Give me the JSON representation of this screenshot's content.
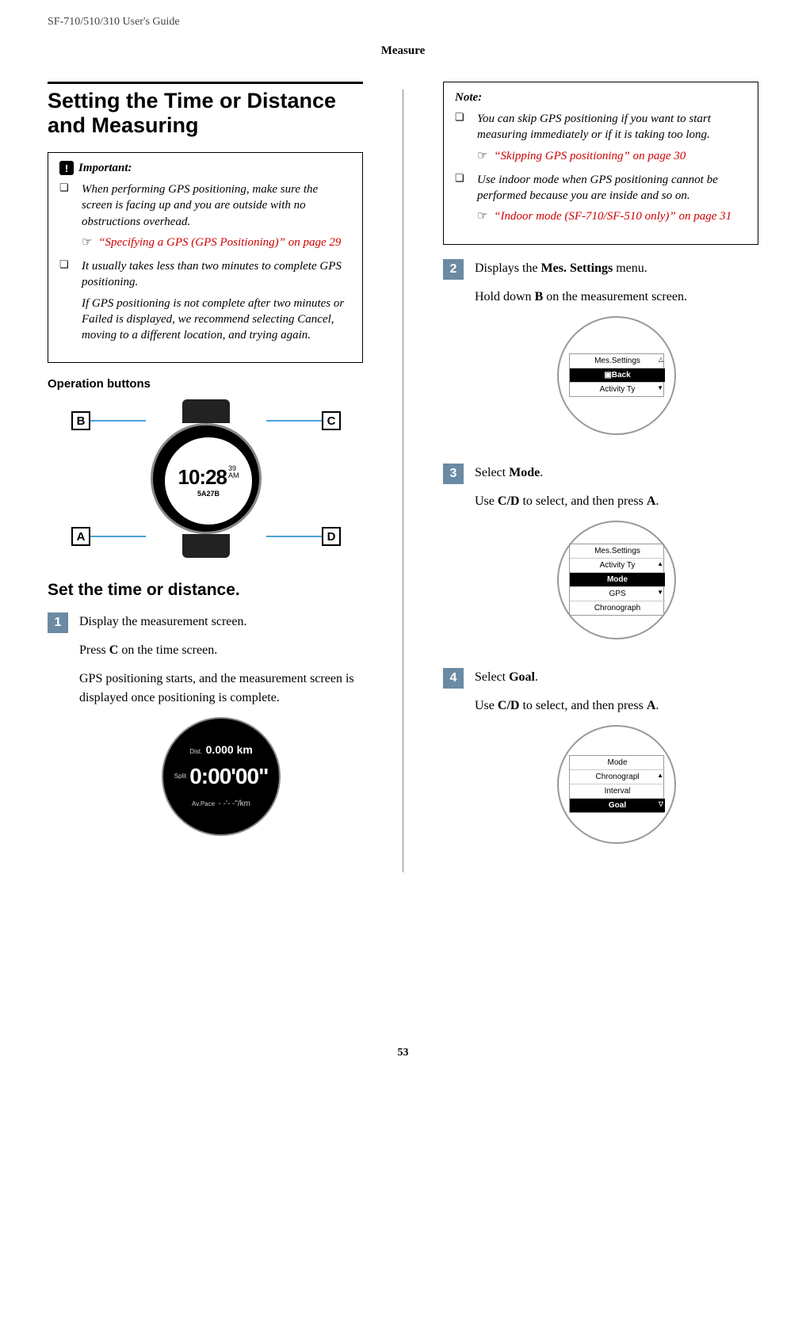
{
  "header": {
    "product": "SF-710/510/310     User's Guide",
    "section": "Measure"
  },
  "left": {
    "title": "Setting the Time or Distance and Measuring",
    "important": {
      "label": "Important:",
      "items": [
        {
          "text": "When performing GPS positioning, make sure the screen is facing up and you are outside with no obstructions overhead.",
          "link": "“Specifying a GPS (GPS Positioning)” on page 29"
        },
        {
          "text": "It usually takes less than two minutes to complete GPS positioning.",
          "followup": "If GPS positioning is not complete after two minutes or Failed is displayed, we recommend selecting Cancel, moving to a different location, and trying again."
        }
      ]
    },
    "op_buttons": "Operation buttons",
    "buttons": {
      "A": "A",
      "B": "B",
      "C": "C",
      "D": "D"
    },
    "watch": {
      "time": "10:28",
      "sec": "39",
      "ampm": "AM",
      "date": "5A27B"
    },
    "subtitle": "Set the time or distance.",
    "step1": {
      "num": "1",
      "lead": "Display the measurement screen.",
      "p2_pre": "Press ",
      "p2_bold": "C",
      "p2_post": " on the time screen.",
      "p3": "GPS positioning starts, and the measurement screen is displayed once positioning is complete.",
      "screen": {
        "dist_label": "Dist.",
        "dist": "0.000 km",
        "split_label": "Split",
        "time": "0:00'00\"",
        "pace_label": "Av.Pace",
        "pace": "- -'- -\"/km"
      }
    }
  },
  "right": {
    "note": {
      "label": "Note:",
      "items": [
        {
          "text": "You can skip GPS positioning if you want to start measuring immediately or if it is taking too long.",
          "link": "“Skipping GPS positioning” on page 30"
        },
        {
          "text": "Use indoor mode when GPS positioning cannot be performed because you are inside and so on.",
          "link": "“Indoor mode (SF-710/SF-510 only)” on page 31"
        }
      ]
    },
    "step2": {
      "num": "2",
      "lead_pre": "Displays the ",
      "lead_bold": "Mes. Settings",
      "lead_post": " menu.",
      "p2_pre": "Hold down ",
      "p2_bold": "B",
      "p2_post": " on the measurement screen.",
      "screen": {
        "title": "Mes.Settings",
        "highlight": "Back",
        "row2": "Activity Ty"
      }
    },
    "step3": {
      "num": "3",
      "lead_pre": "Select ",
      "lead_bold": "Mode",
      "lead_post": ".",
      "p2_pre": "Use ",
      "p2_bold": "C/D",
      "p2_mid": " to select, and then press ",
      "p2_bold2": "A",
      "p2_post": ".",
      "screen": {
        "title": "Mes.Settings",
        "row1": "Activity Ty",
        "highlight": "Mode",
        "row3": "GPS",
        "row4": "Chronograph"
      }
    },
    "step4": {
      "num": "4",
      "lead_pre": "Select ",
      "lead_bold": "Goal",
      "lead_post": ".",
      "p2_pre": "Use ",
      "p2_bold": "C/D",
      "p2_mid": " to select, and then press ",
      "p2_bold2": "A",
      "p2_post": ".",
      "screen": {
        "title": "Mode",
        "row1": "Chronograpl",
        "row2": "Interval",
        "highlight": "Goal"
      }
    }
  },
  "page_num": "53"
}
